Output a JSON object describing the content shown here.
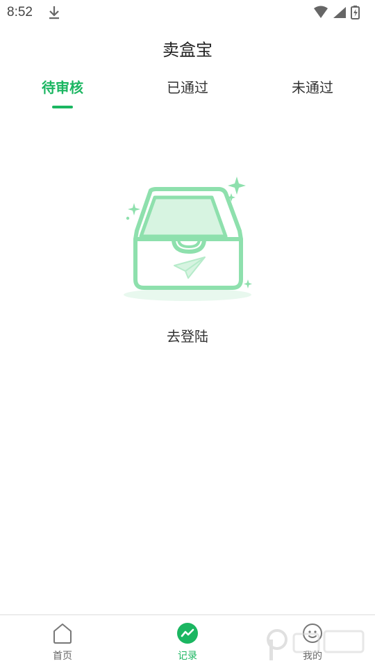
{
  "status_bar": {
    "time": "8:52"
  },
  "header": {
    "title": "卖盒宝"
  },
  "tabs": [
    {
      "label": "待审核",
      "active": true
    },
    {
      "label": "已通过",
      "active": false
    },
    {
      "label": "未通过",
      "active": false
    }
  ],
  "empty_state": {
    "illustration": "empty-inbox-illustration",
    "action_label": "去登陆"
  },
  "bottom_nav": [
    {
      "label": "首页",
      "icon": "home-icon",
      "active": false
    },
    {
      "label": "记录",
      "icon": "chart-trend-icon",
      "active": true
    },
    {
      "label": "我的",
      "icon": "face-icon",
      "active": false
    }
  ],
  "colors": {
    "accent": "#1bb661",
    "illustration_green": "#8ee0ad",
    "illustration_fill": "#d7f4e1",
    "divider": "#dddddd"
  }
}
